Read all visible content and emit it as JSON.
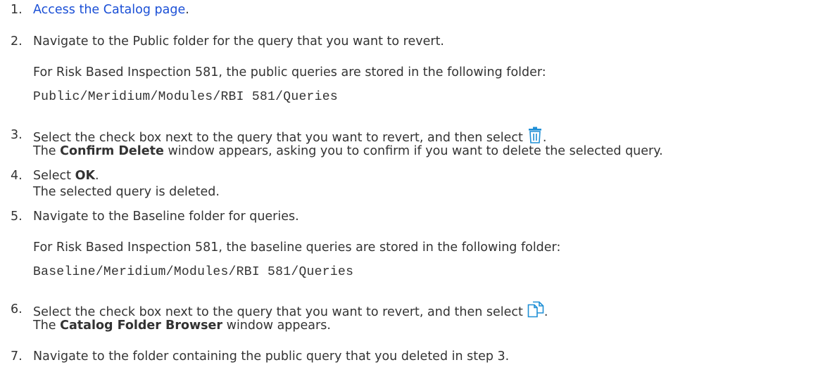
{
  "steps": [
    {
      "num": "1.",
      "link": "Access the Catalog page",
      "tail": "."
    },
    {
      "num": "2.",
      "text": "Navigate to the Public folder for the query that you want to revert.",
      "note": "For Risk Based Inspection 581, the public queries are stored in the following folder:",
      "path": "Public/Meridium/Modules/RBI 581/Queries"
    },
    {
      "num": "3.",
      "text": "Select the check box next to the query that you want to revert, and then select",
      "tail": ".",
      "icon": "trash-icon",
      "result_pre": "The ",
      "result_bold": "Confirm Delete",
      "result_post": " window appears, asking you to confirm if you want to delete the selected query."
    },
    {
      "num": "4.",
      "pre": "Select ",
      "bold": "OK",
      "tail": ".",
      "result": "The selected query is deleted."
    },
    {
      "num": "5.",
      "text": "Navigate to the Baseline folder for queries.",
      "note": "For Risk Based Inspection 581, the baseline queries are stored in the following folder:",
      "path": "Baseline/Meridium/Modules/RBI 581/Queries"
    },
    {
      "num": "6.",
      "text": "Select the check box next to the query that you want to revert, and then select",
      "tail": ".",
      "icon": "copy-icon",
      "result_pre": "The ",
      "result_bold": "Catalog Folder Browser",
      "result_post": " window appears."
    },
    {
      "num": "7.",
      "text": "Navigate to the folder containing the public query that you deleted in step 3."
    }
  ],
  "colors": {
    "text": "#333333",
    "link": "#1a4fd6",
    "icon": "#1f8fd6"
  }
}
